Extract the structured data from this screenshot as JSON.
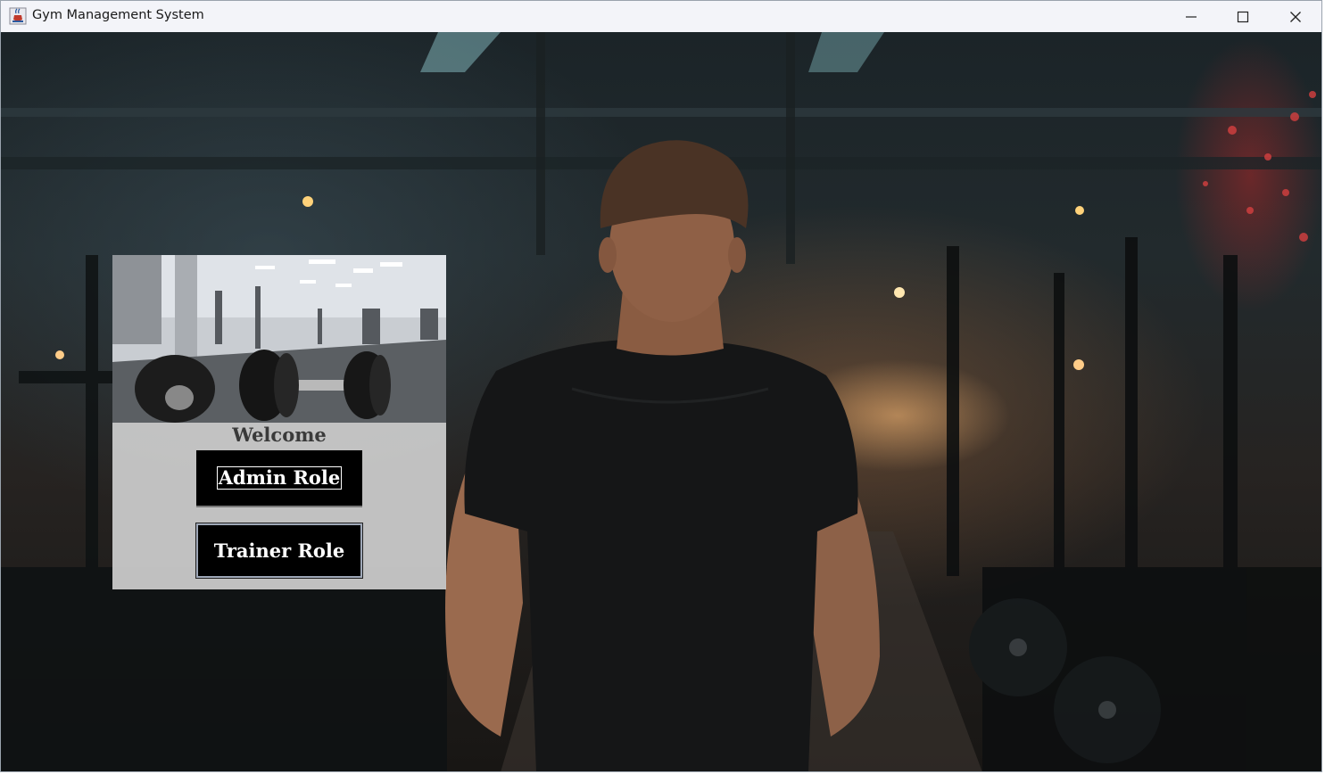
{
  "window": {
    "title": "Gym Management System",
    "icons": {
      "app": "java-cup-icon",
      "minimize": "minimize-icon",
      "maximize": "maximize-icon",
      "close": "close-icon"
    }
  },
  "panel": {
    "image": "dumbbells-gym-photo",
    "welcome": "Welcome",
    "buttons": {
      "admin": "Admin Role",
      "trainer": "Trainer Role"
    }
  },
  "background": {
    "image": "man-in-gym-photo"
  },
  "colors": {
    "titlebar": "#f3f4f9",
    "button_bg": "#000000",
    "button_text": "#ffffff",
    "panel_bg": "#cdcdcd"
  }
}
